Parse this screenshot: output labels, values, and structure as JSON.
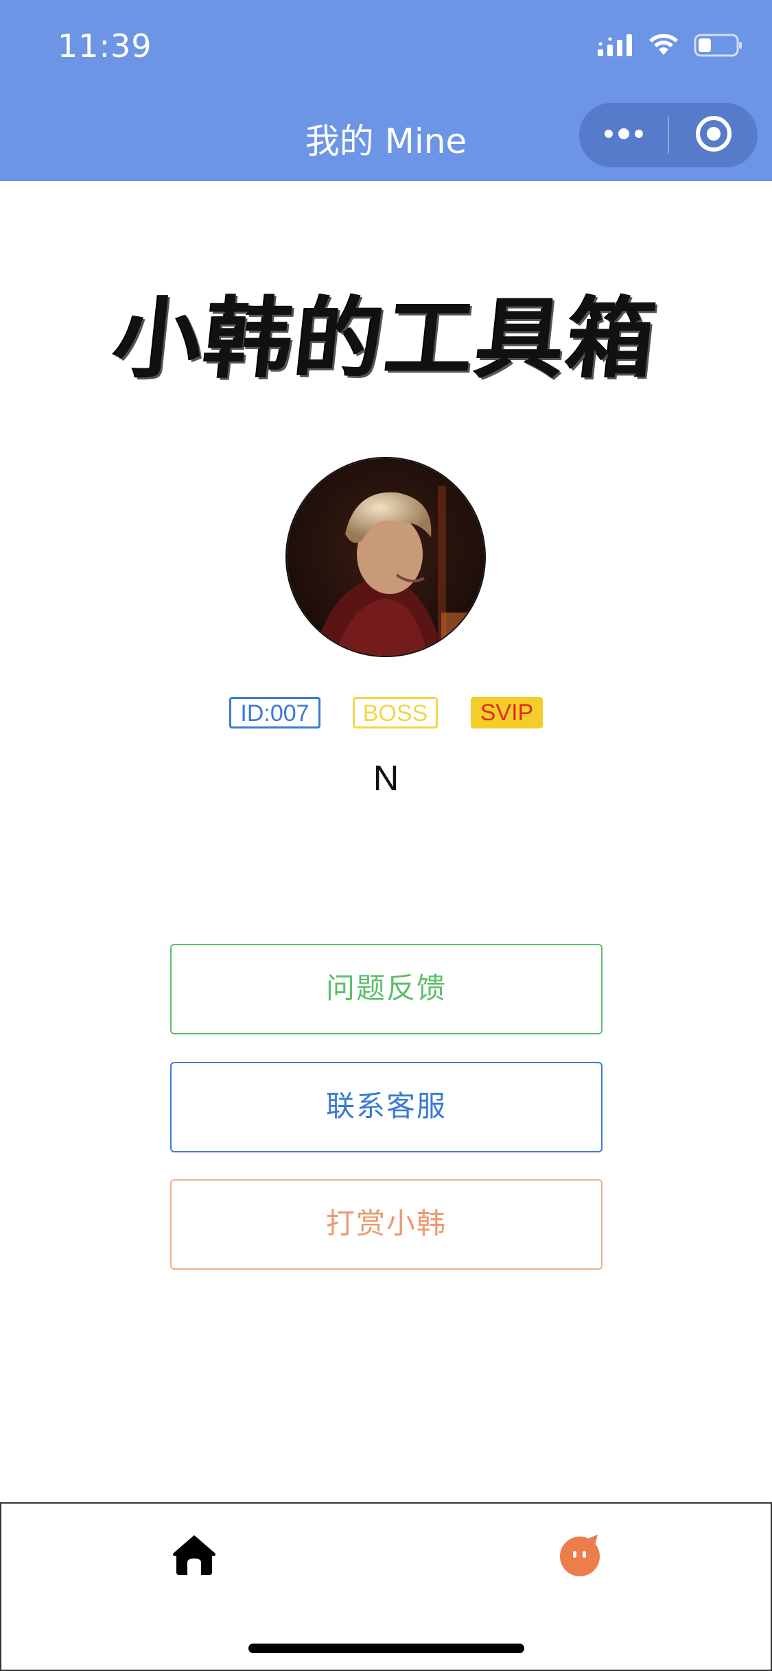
{
  "status_bar": {
    "time": "11:39",
    "icons": [
      "cellular-signal-icon",
      "wifi-icon",
      "battery-icon"
    ]
  },
  "nav": {
    "title": "我的 Mine",
    "capsule_icons": [
      "more-dots-icon",
      "close-miniprogram-icon"
    ]
  },
  "profile": {
    "app_logo_text": "小韩的工具箱",
    "avatar": "avatar-photo",
    "badges": {
      "id": "ID:007",
      "boss": "BOSS",
      "svip": "SVIP"
    },
    "username": "N"
  },
  "actions": {
    "feedback": "问题反馈",
    "customer_service": "联系客服",
    "reward": "打赏小韩"
  },
  "tabbar": {
    "items": [
      "home-icon",
      "mine-icon"
    ],
    "active": "mine"
  },
  "colors": {
    "header_bg": "#6d95e6",
    "feedback": "#5cbf6a",
    "service": "#3a7bd5",
    "reward": "#ec9a6e",
    "boss": "#f2d54a",
    "svip_bg": "#f5cd2a",
    "svip_text": "#d8301f",
    "mine_tab": "#ee7d4c"
  }
}
